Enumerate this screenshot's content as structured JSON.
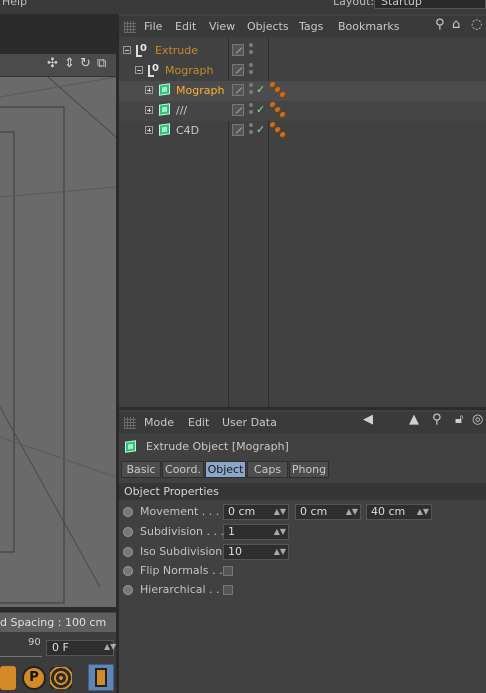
{
  "top": {
    "help": "Help",
    "layout_label": "Layout:",
    "layout_value": "Startup"
  },
  "viewport": {
    "status": "d Spacing : 100 cm"
  },
  "timeline": {
    "frame_marker": "90",
    "current_frame": "0 F"
  },
  "object_manager": {
    "menu": [
      "File",
      "Edit",
      "View",
      "Objects",
      "Tags",
      "Bookmarks"
    ],
    "objects": [
      {
        "name": "Extrude",
        "color": "#c68a2a",
        "icon": "null-icon"
      },
      {
        "name": "Mograph",
        "color": "#c68a2a",
        "icon": "null-icon"
      },
      {
        "name": "Mograph",
        "color": "#ffb02e",
        "icon": "cube-icon"
      },
      {
        "name": "///",
        "color": "#c9c9c9",
        "icon": "cube-icon"
      },
      {
        "name": "C4D",
        "color": "#c9c9c9",
        "icon": "cube-icon"
      }
    ]
  },
  "attribute_manager": {
    "menu": [
      "Mode",
      "Edit",
      "User Data"
    ],
    "title": "Extrude Object [Mograph]",
    "tabs": [
      "Basic",
      "Coord.",
      "Object",
      "Caps",
      "Phong"
    ],
    "active_tab": "Object",
    "section": "Object Properties",
    "properties": {
      "movement": {
        "label": "Movement . . . .",
        "x": "0 cm",
        "y": "0 cm",
        "z": "40 cm"
      },
      "subdivision": {
        "label": "Subdivision . . .",
        "value": "1"
      },
      "iso_subdivision": {
        "label": "Iso Subdivision",
        "value": "10"
      },
      "flip_normals": {
        "label": "Flip Normals . ."
      },
      "hierarchical": {
        "label": "Hierarchical . . ."
      }
    }
  },
  "colors": {
    "accent_tab": "#8aa6c9",
    "tag_orange": "#c86f1f",
    "check_green": "#8ee08e"
  }
}
